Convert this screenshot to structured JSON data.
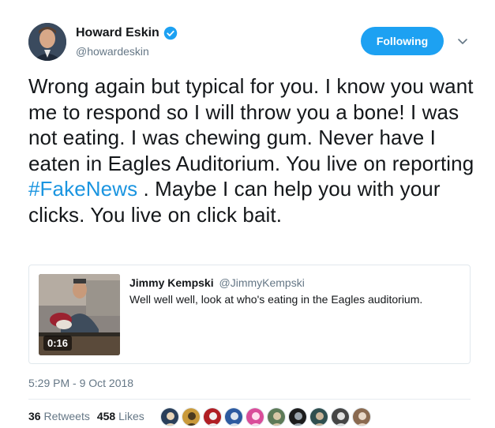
{
  "author": {
    "name": "Howard Eskin",
    "handle": "@howardeskin",
    "verified": true
  },
  "follow_button": {
    "label": "Following"
  },
  "tweet": {
    "text_before_hashtag": "Wrong again but typical for you.  I know you want me to respond so I will throw you a bone! I was not eating.  I was chewing gum.  Never have I eaten in Eagles Auditorium. You live on reporting ",
    "hashtag": "#FakeNews",
    "text_after_hashtag": " . Maybe I can help you with your clicks. You live on click bait."
  },
  "quoted_tweet": {
    "author_name": "Jimmy Kempski",
    "author_handle": "@JimmyKempski",
    "text": "Well well well, look at who's eating in the Eagles auditorium.",
    "video_duration": "0:16"
  },
  "timestamp": "5:29 PM - 9 Oct 2018",
  "stats": {
    "retweets_count": "36",
    "retweets_label": "Retweets",
    "likes_count": "458",
    "likes_label": "Likes"
  },
  "colors": {
    "accent": "#1da1f2",
    "hashtag": "#1b95e0",
    "secondary_text": "#657786"
  },
  "liker_avatars": [
    {
      "bg": "#2a3f5a",
      "fg": "#e8d4b8"
    },
    {
      "bg": "#c99a3b",
      "fg": "#4a3a20"
    },
    {
      "bg": "#b01e24",
      "fg": "#f2f2f2"
    },
    {
      "bg": "#2c5aa0",
      "fg": "#dfe6ee"
    },
    {
      "bg": "#d94d9a",
      "fg": "#ffe0ef"
    },
    {
      "bg": "#5d7a58",
      "fg": "#d9c7a6"
    },
    {
      "bg": "#1c1c1c",
      "fg": "#9aa3ab"
    },
    {
      "bg": "#2f4f4f",
      "fg": "#c9b59a"
    },
    {
      "bg": "#454545",
      "fg": "#e0e0e0"
    },
    {
      "bg": "#8a6a50",
      "fg": "#e8d8c8"
    }
  ]
}
